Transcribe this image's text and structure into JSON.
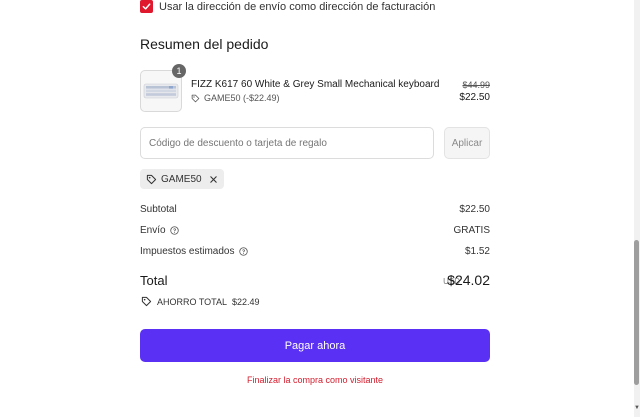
{
  "billing": {
    "checkbox_label": "Usar la dirección de envío como dirección de facturación",
    "checked": true
  },
  "summary": {
    "title": "Resumen del pedido",
    "product": {
      "name": "FIZZ K617 60 White & Grey Small Mechanical keyboard",
      "quantity": "1",
      "discount_code_line": "GAME50 (-$22.49)",
      "original_price": "$44.99",
      "price": "$22.50"
    },
    "discount": {
      "placeholder": "Código de descuento o tarjeta de regalo",
      "apply_label": "Aplicar",
      "applied_code": "GAME50"
    },
    "rows": {
      "subtotal_label": "Subtotal",
      "subtotal_value": "$22.50",
      "shipping_label": "Envío",
      "shipping_value": "GRATIS",
      "taxes_label": "Impuestos estimados",
      "taxes_value": "$1.52"
    },
    "total": {
      "label": "Total",
      "currency": "USD",
      "value": "$24.02"
    },
    "savings": {
      "label": "AHORRO TOTAL",
      "value": "$22.49"
    }
  },
  "actions": {
    "pay_label": "Pagar ahora",
    "guest_label": "Finalizar la compra como visitante"
  },
  "icons": {
    "check": "checkmark-icon",
    "tag": "tag-icon",
    "close": "close-icon",
    "info": "info-icon"
  },
  "colors": {
    "accent": "#5a31f4",
    "checkbox": "#e0182d",
    "link": "#d21c2c"
  }
}
